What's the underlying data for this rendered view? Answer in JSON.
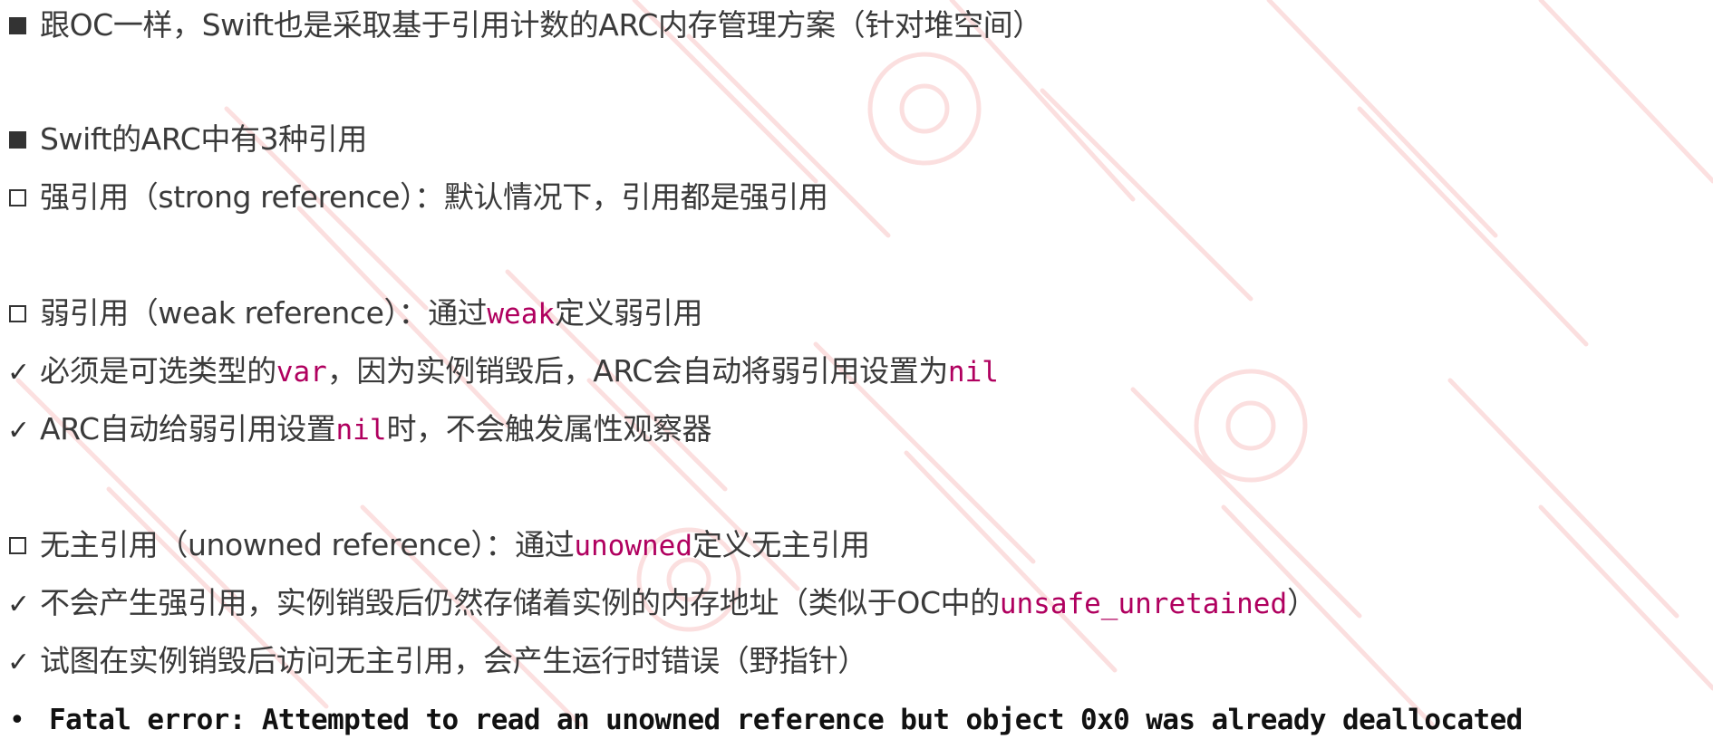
{
  "lines": {
    "l1": {
      "text": "跟OC一样，Swift也是采取基于引用计数的ARC内存管理方案（针对堆空间）"
    },
    "l2": {
      "text": "Swift的ARC中有3种引用"
    },
    "l3": {
      "text": "强引用（strong reference）：默认情况下，引用都是强引用"
    },
    "l4": {
      "pre": "弱引用（weak reference）：通过",
      "kw": "weak",
      "post": "定义弱引用"
    },
    "l5": {
      "pre": "必须是可选类型的",
      "kw": "var",
      "mid": "，因为实例销毁后，ARC会自动将弱引用设置为",
      "kw2": "nil"
    },
    "l6": {
      "pre": "ARC自动给弱引用设置",
      "kw": "nil",
      "post": "时，不会触发属性观察器"
    },
    "l7": {
      "pre": "无主引用（unowned reference）：通过",
      "kw": "unowned",
      "post": "定义无主引用"
    },
    "l8": {
      "pre": "不会产生强引用，实例销毁后仍然存储着实例的内存地址（类似于OC中的",
      "kw": "unsafe_unretained",
      "post": "）"
    },
    "l9": {
      "text": "试图在实例销毁后访问无主引用，会产生运行时错误（野指针）"
    },
    "l10": {
      "text": "Fatal error: Attempted to read an unowned reference but object 0x0 was already deallocated"
    }
  },
  "bullets": {
    "check": "✓",
    "dot": "•"
  },
  "colors": {
    "text": "#3a3a3a",
    "keyword": "#b0005f",
    "watermark": "#fbdcdc"
  }
}
